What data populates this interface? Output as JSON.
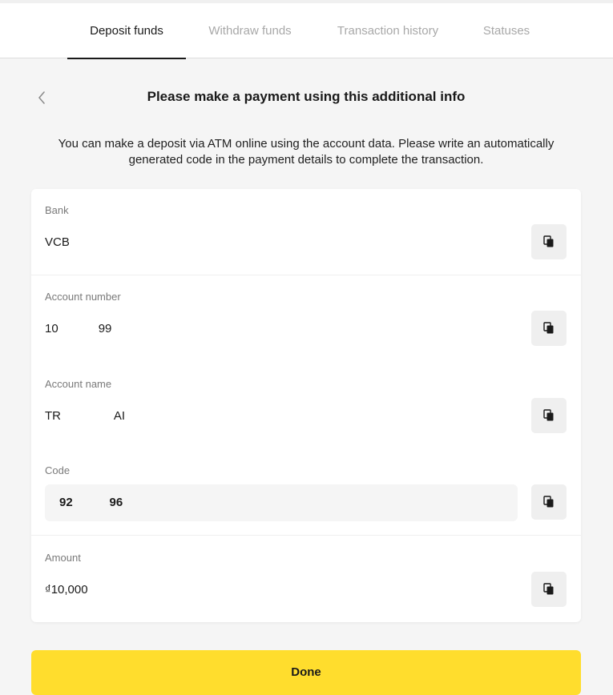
{
  "tabs": [
    {
      "label": "Deposit funds",
      "active": true
    },
    {
      "label": "Withdraw funds",
      "active": false
    },
    {
      "label": "Transaction history",
      "active": false
    },
    {
      "label": "Statuses",
      "active": false
    }
  ],
  "header": {
    "back_icon": "chevron-left-icon",
    "title": "Please make a payment using this additional info"
  },
  "description": "You can make a deposit via ATM online using the account data. Please write an automatically generated code in the payment details to complete the transaction.",
  "fields": [
    {
      "label": "Bank",
      "value": "VCB"
    },
    {
      "label": "Account number",
      "value": "10            99"
    },
    {
      "label": "Account name",
      "value": "TR                AI"
    },
    {
      "label": "Code",
      "value": "92           96"
    },
    {
      "label": "Amount",
      "value": "₫10,000"
    }
  ],
  "copy_icon": "copy-icon",
  "done_label": "Done",
  "colors": {
    "accent": "#ffdd2d",
    "background": "#f5f5f5",
    "card": "#ffffff",
    "tab_inactive": "#a8a8a8"
  }
}
